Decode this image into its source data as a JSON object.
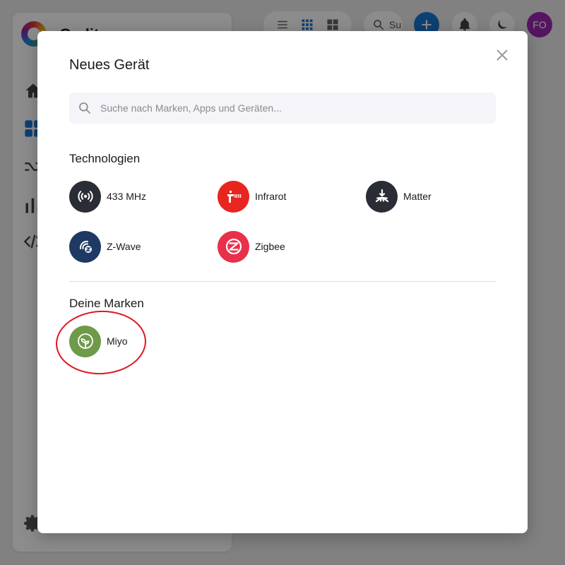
{
  "background": {
    "app_title": "Gedit",
    "search_placeholder": "Su",
    "avatar_initials": "FO"
  },
  "dialog": {
    "title": "Neues Gerät",
    "search": {
      "placeholder": "Suche nach Marken, Apps und Geräten...",
      "value": ""
    },
    "technologies": {
      "title": "Technologien",
      "items": [
        {
          "label": "433 MHz",
          "icon": "radio-waves-icon",
          "color": "#2b2d36"
        },
        {
          "label": "Infrarot",
          "icon": "infrared-icon",
          "color": "#e8251f"
        },
        {
          "label": "Matter",
          "icon": "matter-icon",
          "color": "#2b2d36"
        },
        {
          "label": "Z-Wave",
          "icon": "zwave-icon",
          "color": "#1e3a64"
        },
        {
          "label": "Zigbee",
          "icon": "zigbee-icon",
          "color": "#e8304a"
        }
      ]
    },
    "brands": {
      "title": "Deine Marken",
      "items": [
        {
          "label": "Miyo",
          "icon": "miyo-leaf-icon",
          "color": "#6e9a4a"
        }
      ]
    }
  },
  "colors": {
    "accent": "#1976d2",
    "annotation": "#e0161e"
  }
}
